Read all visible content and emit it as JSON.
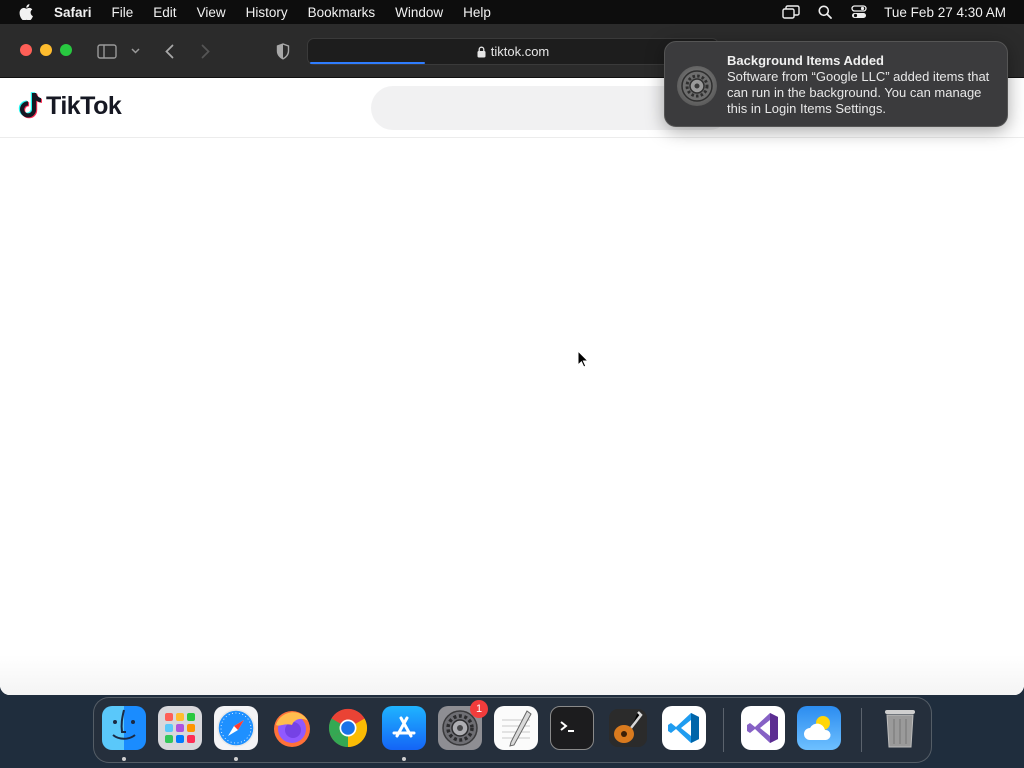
{
  "menubar": {
    "app_name": "Safari",
    "items": [
      "File",
      "Edit",
      "View",
      "History",
      "Bookmarks",
      "Window",
      "Help"
    ],
    "clock": "Tue Feb 27  4:30 AM"
  },
  "browser": {
    "url": "tiktok.com",
    "load_progress": 0.28
  },
  "page": {
    "logo_text": "TikTok"
  },
  "notification": {
    "title": "Background Items Added",
    "body": "Software from “Google LLC” added items that can run in the background. You can manage this in Login Items Settings."
  },
  "dock": {
    "apps": [
      {
        "name": "finder-icon",
        "running": true
      },
      {
        "name": "launchpad-icon",
        "running": false
      },
      {
        "name": "safari-icon",
        "running": true
      },
      {
        "name": "firefox-icon",
        "running": false
      },
      {
        "name": "chrome-icon",
        "running": false
      },
      {
        "name": "app-store-icon",
        "running": true
      },
      {
        "name": "system-settings-icon",
        "running": false,
        "badge": "1"
      },
      {
        "name": "textedit-icon",
        "running": false
      },
      {
        "name": "terminal-icon",
        "running": false
      },
      {
        "name": "garageband-icon",
        "running": false
      },
      {
        "name": "vscode-icon",
        "running": false
      },
      {
        "name": "visual-studio-icon",
        "running": false
      },
      {
        "name": "weather-icon",
        "running": false
      },
      {
        "name": "trash-icon",
        "running": false
      }
    ]
  },
  "colors": {
    "accent": "#2f7dff",
    "close": "#fe5f57",
    "minimize": "#febc2e",
    "zoom": "#28c840",
    "badge": "#f23c3c"
  }
}
